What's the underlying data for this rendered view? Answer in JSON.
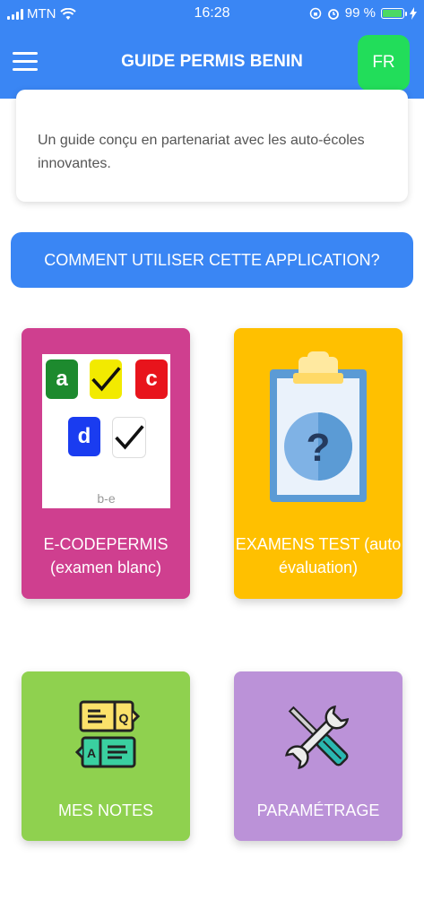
{
  "status": {
    "carrier": "MTN",
    "time": "16:28",
    "battery": "99 %"
  },
  "header": {
    "title": "GUIDE PERMIS BENIN",
    "lang": "FR"
  },
  "info": {
    "text": "Un guide conçu en partenariat avec les auto-écoles innovantes."
  },
  "how_button": "COMMENT UTILISER CETTE APPLICATION?",
  "tiles": [
    {
      "line1": "E-CODEPERMIS",
      "line2": "(examen blanc)"
    },
    {
      "line1": "EXAMENS TEST (auto",
      "line2": "évaluation)"
    },
    {
      "line1": "MES NOTES"
    },
    {
      "line1": "PARAMÉTRAGE"
    }
  ],
  "quiz_image": {
    "letters": [
      "a",
      "c",
      "d"
    ],
    "caption": "b-e"
  },
  "notes_icon": {
    "q": "Q",
    "a": "A"
  },
  "colors": {
    "header": "#3a86f4",
    "lang_button": "#22dd5a",
    "tile_codepermis": "#cf3f8f",
    "tile_examens": "#ffc000",
    "tile_notes": "#8fd14f",
    "tile_parametrage": "#bb92d8"
  },
  "icons": [
    "signal-icon",
    "wifi-icon",
    "lock-rotation-icon",
    "alarm-icon",
    "battery-icon",
    "menu-icon",
    "clipboard-question-icon",
    "notes-qa-icon",
    "tools-icon"
  ]
}
